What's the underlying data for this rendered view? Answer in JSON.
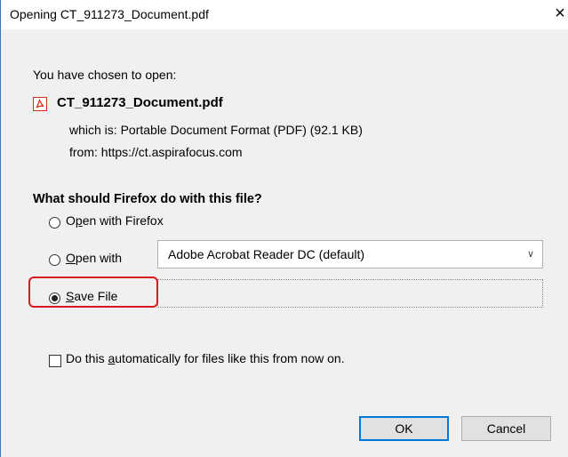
{
  "window": {
    "title": "Opening CT_911273_Document.pdf",
    "close_icon": "×"
  },
  "info": {
    "chosen_label": "You have chosen to open:",
    "file_name": "CT_911273_Document.pdf",
    "which_is_label": "which is:",
    "which_is_value": "Portable Document Format (PDF) (92.1 KB)",
    "from_label": "from:",
    "from_value": "https://ct.aspirafocus.com"
  },
  "question": "What should Firefox do with this file?",
  "options": {
    "open_firefox": {
      "prefix": "O",
      "accel": "p",
      "suffix": "en with Firefox",
      "selected": false
    },
    "open_with": {
      "prefix": "",
      "accel": "O",
      "suffix": "pen with",
      "selected": false,
      "app": "Adobe Acrobat Reader DC (default)"
    },
    "save_file": {
      "prefix": "",
      "accel": "S",
      "suffix": "ave File",
      "selected": true
    }
  },
  "auto": {
    "prefix": "Do this ",
    "accel": "a",
    "suffix": "utomatically for files like this from now on.",
    "checked": false
  },
  "buttons": {
    "ok": "OK",
    "cancel": "Cancel"
  },
  "colors": {
    "accent": "#0078d7",
    "highlight": "#d9191f",
    "border": "#3b78c4"
  }
}
